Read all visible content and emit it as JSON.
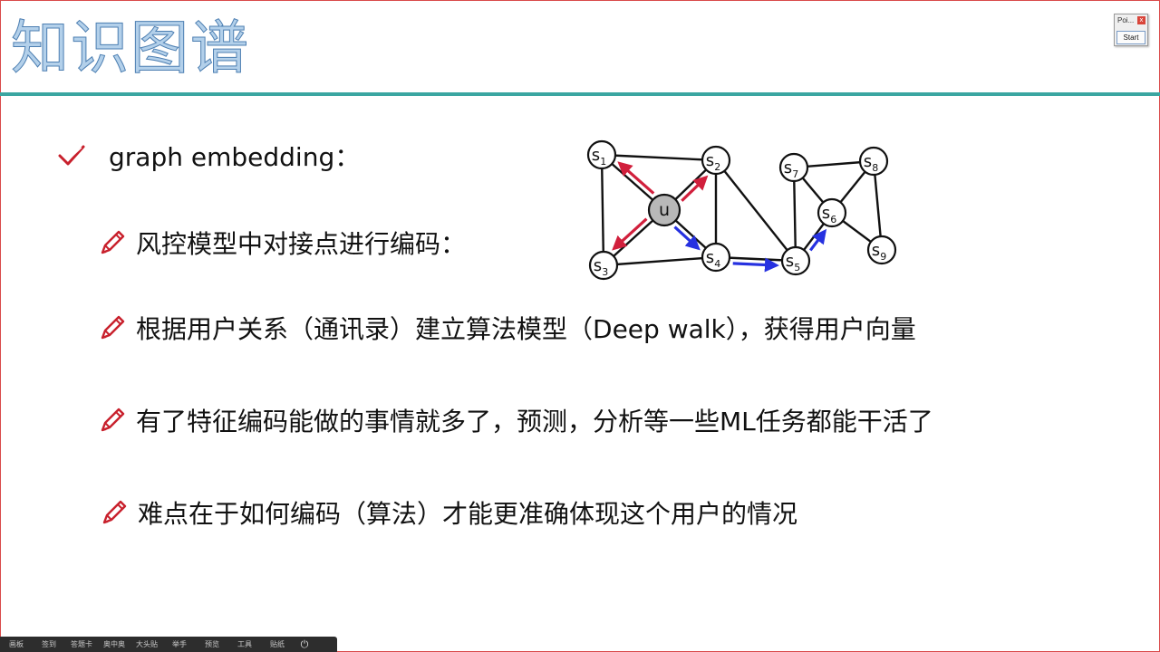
{
  "slide": {
    "title": "知识图谱",
    "bullets": [
      {
        "text": "graph embedding："
      },
      {
        "text": "风控模型中对接点进行编码："
      },
      {
        "text": "根据用户关系（通讯录）建立算法模型（Deep walk），获得用户向量"
      },
      {
        "text": "有了特征编码能做的事情就多了，预测，分析等一些ML任务都能干活了"
      },
      {
        "text": "难点在于如何编码（算法）才能更准确体现这个用户的情况"
      }
    ],
    "colors": {
      "title_fill": "#b3d0ea",
      "title_stroke": "#4d7fb2",
      "rule": "#3aa6a1",
      "icon": "#c8202c",
      "arrow_red": "#d11f3c",
      "arrow_blue": "#2631e0"
    }
  },
  "graph": {
    "nodes": [
      {
        "id": "u",
        "label": "u"
      },
      {
        "id": "s1",
        "label": "s",
        "sub": "1"
      },
      {
        "id": "s2",
        "label": "s",
        "sub": "2"
      },
      {
        "id": "s3",
        "label": "s",
        "sub": "3"
      },
      {
        "id": "s4",
        "label": "s",
        "sub": "4"
      },
      {
        "id": "s5",
        "label": "s",
        "sub": "5"
      },
      {
        "id": "s6",
        "label": "s",
        "sub": "6"
      },
      {
        "id": "s7",
        "label": "s",
        "sub": "7"
      },
      {
        "id": "s8",
        "label": "s",
        "sub": "8"
      },
      {
        "id": "s9",
        "label": "s",
        "sub": "9"
      }
    ],
    "edges": [
      [
        "s1",
        "s2"
      ],
      [
        "s1",
        "s3"
      ],
      [
        "s1",
        "u"
      ],
      [
        "s2",
        "u"
      ],
      [
        "s2",
        "s4"
      ],
      [
        "s2",
        "s5"
      ],
      [
        "s3",
        "u"
      ],
      [
        "s3",
        "s4"
      ],
      [
        "u",
        "s4"
      ],
      [
        "s4",
        "s5"
      ],
      [
        "s5",
        "s7"
      ],
      [
        "s5",
        "s6"
      ],
      [
        "s6",
        "s7"
      ],
      [
        "s6",
        "s8"
      ],
      [
        "s6",
        "s9"
      ],
      [
        "s7",
        "s8"
      ],
      [
        "s8",
        "s9"
      ]
    ],
    "arrows": [
      {
        "from": "u",
        "to": "s1",
        "color": "red"
      },
      {
        "from": "u",
        "to": "s2",
        "color": "red"
      },
      {
        "from": "u",
        "to": "s3",
        "color": "red"
      },
      {
        "from": "u",
        "to": "s4",
        "color": "blue"
      },
      {
        "from": "s4",
        "to": "s5",
        "color": "blue"
      },
      {
        "from": "s5",
        "to": "s6",
        "color": "blue"
      }
    ]
  },
  "widget": {
    "title": "Poi...",
    "close": "x",
    "button": "Start"
  },
  "taskbar": {
    "items": [
      "画板",
      "签到",
      "答题卡",
      "奥中奥",
      "大头贴",
      "举手",
      "预览",
      "工具",
      "贴纸"
    ],
    "power_icon": "power-icon"
  }
}
